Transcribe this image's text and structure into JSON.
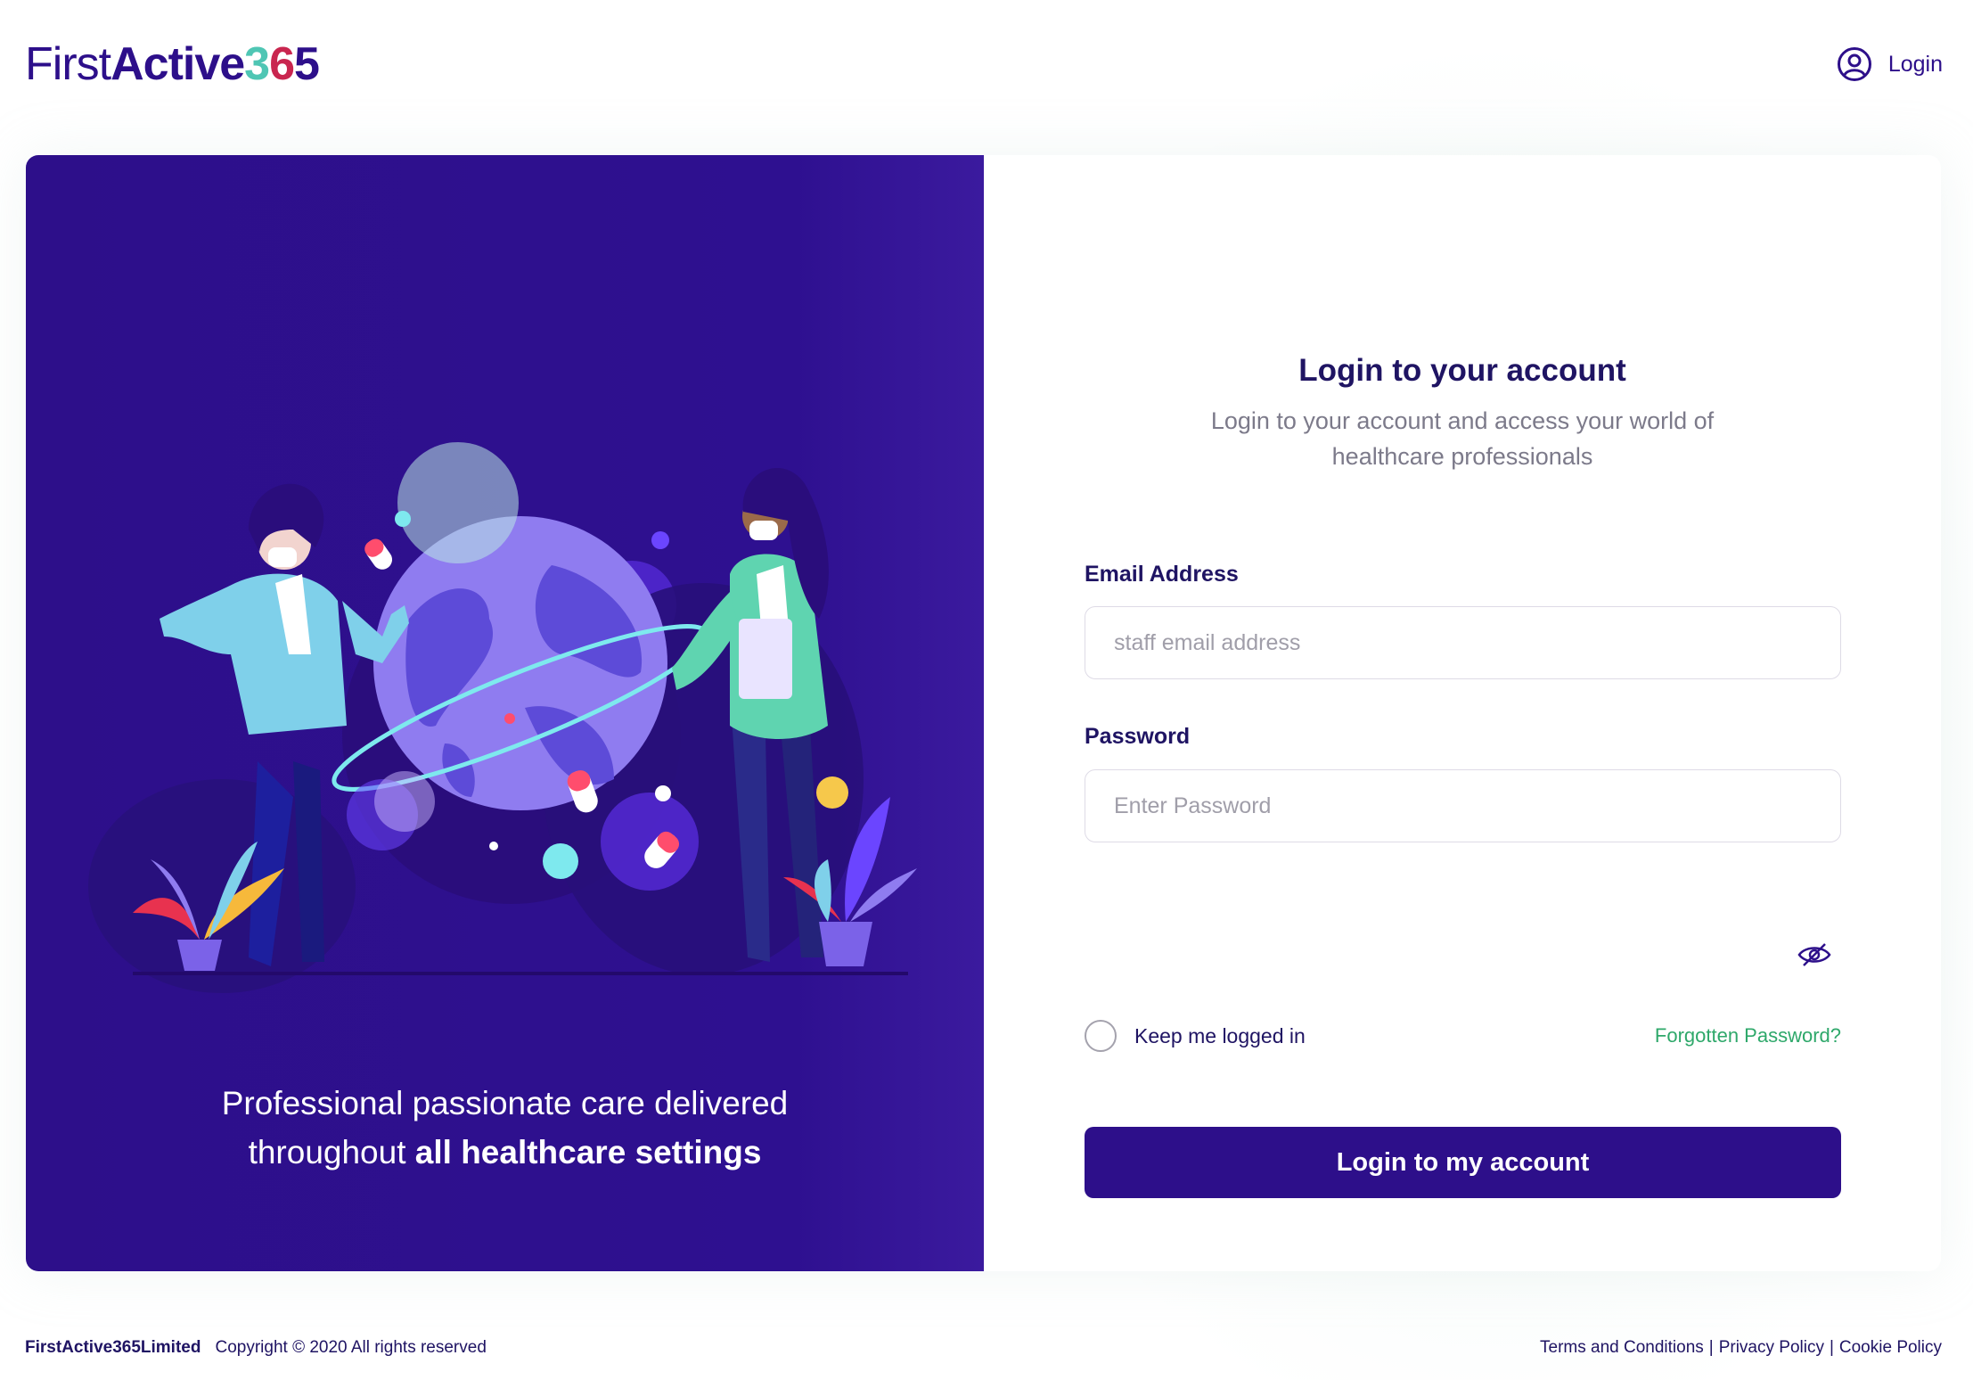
{
  "header": {
    "logo": {
      "part1": "First",
      "part2": "Active",
      "d3": "3",
      "d6": "6",
      "d5": "5"
    },
    "login_label": "Login"
  },
  "hero": {
    "caption_line1": "Professional passionate care delivered",
    "caption_line2_prefix": "throughout",
    "caption_line2_strong": "all healthcare settings"
  },
  "form": {
    "title": "Login to your account",
    "subtitle": "Login to your account and access your world of healthcare professionals",
    "email_label": "Email Address",
    "email_placeholder": "staff email address",
    "email_value": "",
    "password_label": "Password",
    "password_placeholder": "Enter Password",
    "password_value": "",
    "keep_logged_in_label": "Keep me logged in",
    "keep_logged_in_checked": false,
    "forgot_label": "Forgotten Password?",
    "submit_label": "Login to my account"
  },
  "footer": {
    "company": "FirstActive365Limited",
    "copyright": "Copyright © 2020 All rights reserved",
    "links": [
      "Terms and Conditions",
      "Privacy Policy",
      "Cookie Policy"
    ],
    "separator": "|"
  },
  "colors": {
    "brand_purple": "#2d0f8a",
    "accent_teal": "#4fc6b4",
    "accent_red": "#c9264f",
    "link_green": "#2ea86a"
  }
}
